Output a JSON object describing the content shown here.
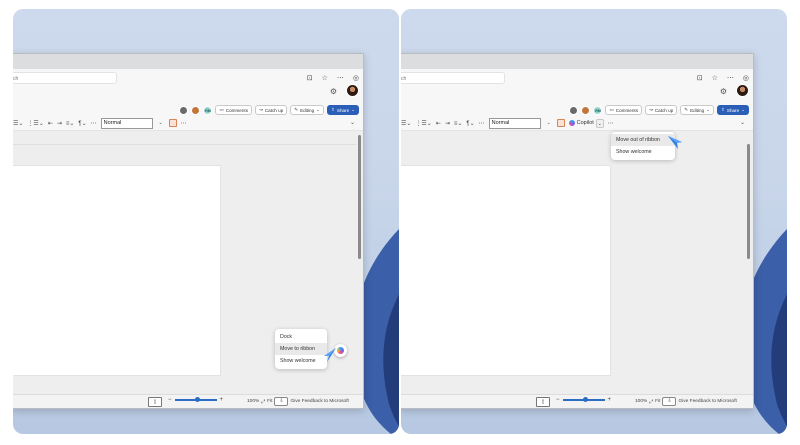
{
  "left": {
    "address_text": "ch",
    "collab": {
      "initials": "RM",
      "comments": "Comments",
      "catch_up": "Catch up",
      "editing": "Editing",
      "share": "Share"
    },
    "toolbar": {
      "style_value": "Normal"
    },
    "menu": {
      "items": [
        "Dock",
        "Move to ribbon",
        "Show welcome"
      ],
      "highlighted": "Move to ribbon"
    },
    "status": {
      "zoom": "100%",
      "fit": "Fit",
      "feedback": "Give Feedback to Microsoft",
      "minus": "−",
      "plus": "+"
    }
  },
  "right": {
    "address_text": "ch",
    "collab": {
      "initials": "RM",
      "comments": "Comments",
      "catch_up": "Catch up",
      "editing": "Editing",
      "share": "Share"
    },
    "toolbar": {
      "style_value": "Normal",
      "copilot_label": "Copilot"
    },
    "menu": {
      "items": [
        "Move out of ribbon",
        "Show welcome"
      ],
      "highlighted": "Move out of ribbon"
    },
    "status": {
      "zoom": "100%",
      "fit": "Fit",
      "feedback": "Give Feedback to Microsoft",
      "minus": "−",
      "plus": "+"
    }
  },
  "colors": {
    "share_blue": "#2b5fb7",
    "wallpaper": "#c9d6ea",
    "cursor_blue": "#2f7fe0"
  },
  "icons": [
    "tab-icon",
    "favorites-icon",
    "more-icon",
    "copilot-edge-icon",
    "settings-icon",
    "comment-icon",
    "catch-up-icon",
    "pencil-icon",
    "share-icon",
    "bullets-icon",
    "numbering-icon",
    "indent-icon",
    "align-icon",
    "paragraph-icon",
    "collapse-chevron-icon",
    "page-icon",
    "fit-icon",
    "feedback-icon",
    "copilot-icon"
  ]
}
